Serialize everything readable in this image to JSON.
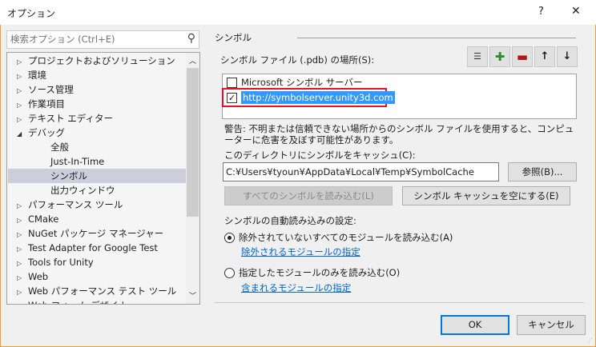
{
  "window": {
    "title": "オプション",
    "help": "?",
    "close": "✕"
  },
  "search": {
    "placeholder": "検索オプション (Ctrl+E)"
  },
  "tree": {
    "items": [
      {
        "label": "プロジェクトおよびソリューション",
        "expander": "▷"
      },
      {
        "label": "環境",
        "expander": "▷"
      },
      {
        "label": "ソース管理",
        "expander": "▷"
      },
      {
        "label": "作業項目",
        "expander": "▷"
      },
      {
        "label": "テキスト エディター",
        "expander": "▷"
      },
      {
        "label": "デバッグ",
        "expander": "◢"
      },
      {
        "label": "全般",
        "expander": ""
      },
      {
        "label": "Just-In-Time",
        "expander": ""
      },
      {
        "label": "シンボル",
        "expander": "",
        "selected": true
      },
      {
        "label": "出力ウィンドウ",
        "expander": ""
      },
      {
        "label": "パフォーマンス ツール",
        "expander": "▷"
      },
      {
        "label": "CMake",
        "expander": "▷"
      },
      {
        "label": "NuGet パッケージ マネージャー",
        "expander": "▷"
      },
      {
        "label": "Test Adapter for Google Test",
        "expander": "▷"
      },
      {
        "label": "Tools for Unity",
        "expander": "▷"
      },
      {
        "label": "Web",
        "expander": "▷"
      },
      {
        "label": "Web パフォーマンス テスト ツール",
        "expander": "▷"
      },
      {
        "label": "Web フォーム デザイナー",
        "expander": "▷"
      }
    ]
  },
  "panel": {
    "section": "シンボル",
    "locations_label": "シンボル ファイル (.pdb) の場所(S):",
    "locations": [
      {
        "label": "Microsoft シンボル サーバー",
        "checked": false
      },
      {
        "label": "http://symbolserver.unity3d.com",
        "checked": true
      }
    ],
    "warning": "警告: 不明または信頼できない場所からのシンボル ファイルを使用すると、コンピューターに危害を及ぼす可能性があります。",
    "cache_label": "このディレクトリにシンボルをキャッシュ(C):",
    "cache_path": "C:¥Users¥tyoun¥AppData¥Local¥Temp¥SymbolCache",
    "browse": "参照(B)...",
    "load_all": "すべてのシンボルを読み込む(L)",
    "empty_cache": "シンボル キャッシュを空にする(E)",
    "auto_label": "シンボルの自動読み込みの設定:",
    "radio1": "除外されていないすべてのモジュールを読み込む(A)",
    "link1": "除外されるモジュールの指定",
    "radio2": "指定したモジュールのみを読み込む(O)",
    "link2": "含まれるモジュールの指定"
  },
  "footer": {
    "ok": "OK",
    "cancel": "キャンセル"
  },
  "colors": {
    "accent": "#0078d7",
    "highlight": "#3399ff",
    "red_box": "#e81123",
    "selected_row": "#cccedb"
  }
}
